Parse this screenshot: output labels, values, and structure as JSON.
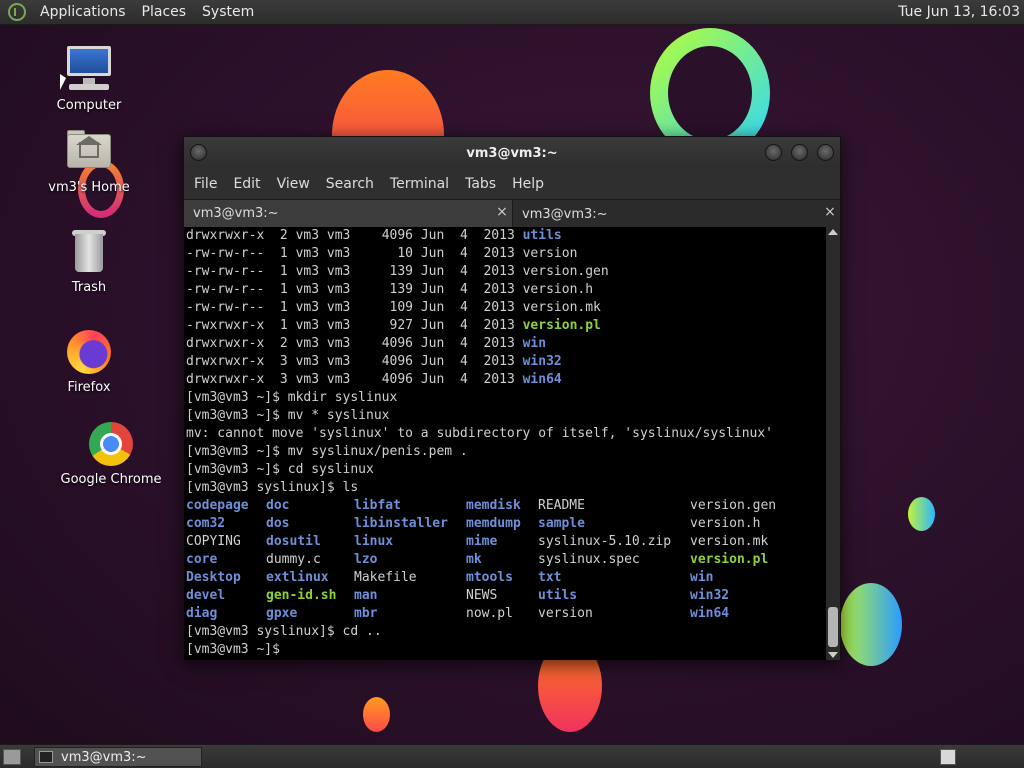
{
  "top_panel": {
    "menus": [
      "Applications",
      "Places",
      "System"
    ],
    "clock": "Tue Jun 13, 16:03"
  },
  "desktop_icons": [
    {
      "label": "Computer",
      "icon": "computer-icon"
    },
    {
      "label": "vm3's Home",
      "icon": "home-folder-icon"
    },
    {
      "label": "Trash",
      "icon": "trash-icon"
    },
    {
      "label": "Firefox",
      "icon": "firefox-icon"
    },
    {
      "label": "Google Chrome",
      "icon": "chrome-icon"
    }
  ],
  "terminal": {
    "title": "vm3@vm3:~",
    "menu": [
      "File",
      "Edit",
      "View",
      "Search",
      "Terminal",
      "Tabs",
      "Help"
    ],
    "tabs": [
      "vm3@vm3:~",
      "vm3@vm3:~"
    ],
    "listing": [
      {
        "perm": "drwxrwxr-x",
        "links": "2",
        "user": "vm3",
        "group": "vm3",
        "size": "4096",
        "month": "Jun",
        "day": "4",
        "year": "2013",
        "name": "utils",
        "kind": "dir"
      },
      {
        "perm": "-rw-rw-r--",
        "links": "1",
        "user": "vm3",
        "group": "vm3",
        "size": "10",
        "month": "Jun",
        "day": "4",
        "year": "2013",
        "name": "version",
        "kind": "file"
      },
      {
        "perm": "-rw-rw-r--",
        "links": "1",
        "user": "vm3",
        "group": "vm3",
        "size": "139",
        "month": "Jun",
        "day": "4",
        "year": "2013",
        "name": "version.gen",
        "kind": "file"
      },
      {
        "perm": "-rw-rw-r--",
        "links": "1",
        "user": "vm3",
        "group": "vm3",
        "size": "139",
        "month": "Jun",
        "day": "4",
        "year": "2013",
        "name": "version.h",
        "kind": "file"
      },
      {
        "perm": "-rw-rw-r--",
        "links": "1",
        "user": "vm3",
        "group": "vm3",
        "size": "109",
        "month": "Jun",
        "day": "4",
        "year": "2013",
        "name": "version.mk",
        "kind": "file"
      },
      {
        "perm": "-rwxrwxr-x",
        "links": "1",
        "user": "vm3",
        "group": "vm3",
        "size": "927",
        "month": "Jun",
        "day": "4",
        "year": "2013",
        "name": "version.pl",
        "kind": "exe"
      },
      {
        "perm": "drwxrwxr-x",
        "links": "2",
        "user": "vm3",
        "group": "vm3",
        "size": "4096",
        "month": "Jun",
        "day": "4",
        "year": "2013",
        "name": "win",
        "kind": "dir"
      },
      {
        "perm": "drwxrwxr-x",
        "links": "3",
        "user": "vm3",
        "group": "vm3",
        "size": "4096",
        "month": "Jun",
        "day": "4",
        "year": "2013",
        "name": "win32",
        "kind": "dir"
      },
      {
        "perm": "drwxrwxr-x",
        "links": "3",
        "user": "vm3",
        "group": "vm3",
        "size": "4096",
        "month": "Jun",
        "day": "4",
        "year": "2013",
        "name": "win64",
        "kind": "dir"
      }
    ],
    "commands": [
      "[vm3@vm3 ~]$ mkdir syslinux",
      "[vm3@vm3 ~]$ mv * syslinux",
      "mv: cannot move 'syslinux' to a subdirectory of itself, 'syslinux/syslinux'",
      "[vm3@vm3 ~]$ mv syslinux/penis.pem .",
      "[vm3@vm3 ~]$ cd syslinux",
      "[vm3@vm3 syslinux]$ ls"
    ],
    "ls_rows": [
      [
        {
          "t": "codepage",
          "k": "dir"
        },
        {
          "t": "doc",
          "k": "dir"
        },
        {
          "t": "libfat",
          "k": "dir"
        },
        {
          "t": "memdisk",
          "k": "dir"
        },
        {
          "t": "README",
          "k": "file"
        },
        {
          "t": "version.gen",
          "k": "file"
        }
      ],
      [
        {
          "t": "com32",
          "k": "dir"
        },
        {
          "t": "dos",
          "k": "dir"
        },
        {
          "t": "libinstaller",
          "k": "dir"
        },
        {
          "t": "memdump",
          "k": "dir"
        },
        {
          "t": "sample",
          "k": "dir"
        },
        {
          "t": "version.h",
          "k": "file"
        }
      ],
      [
        {
          "t": "COPYING",
          "k": "file"
        },
        {
          "t": "dosutil",
          "k": "dir"
        },
        {
          "t": "linux",
          "k": "dir"
        },
        {
          "t": "mime",
          "k": "dir"
        },
        {
          "t": "syslinux-5.10.zip",
          "k": "file"
        },
        {
          "t": "version.mk",
          "k": "file"
        }
      ],
      [
        {
          "t": "core",
          "k": "dir"
        },
        {
          "t": "dummy.c",
          "k": "file"
        },
        {
          "t": "lzo",
          "k": "dir"
        },
        {
          "t": "mk",
          "k": "dir"
        },
        {
          "t": "syslinux.spec",
          "k": "file"
        },
        {
          "t": "version.pl",
          "k": "exe"
        }
      ],
      [
        {
          "t": "Desktop",
          "k": "dir"
        },
        {
          "t": "extlinux",
          "k": "dir"
        },
        {
          "t": "Makefile",
          "k": "file"
        },
        {
          "t": "mtools",
          "k": "dir"
        },
        {
          "t": "txt",
          "k": "dir"
        },
        {
          "t": "win",
          "k": "dir"
        }
      ],
      [
        {
          "t": "devel",
          "k": "dir"
        },
        {
          "t": "gen-id.sh",
          "k": "exe"
        },
        {
          "t": "man",
          "k": "dir"
        },
        {
          "t": "NEWS",
          "k": "file"
        },
        {
          "t": "utils",
          "k": "dir"
        },
        {
          "t": "win32",
          "k": "dir"
        }
      ],
      [
        {
          "t": "diag",
          "k": "dir"
        },
        {
          "t": "gpxe",
          "k": "dir"
        },
        {
          "t": "mbr",
          "k": "dir"
        },
        {
          "t": "now.pl",
          "k": "file"
        },
        {
          "t": "version",
          "k": "file"
        },
        {
          "t": "win64",
          "k": "dir"
        }
      ]
    ],
    "after": [
      "[vm3@vm3 syslinux]$ cd ..",
      "[vm3@vm3 ~]$ "
    ]
  },
  "bottom_panel": {
    "task": "vm3@vm3:~"
  },
  "colors": {
    "dir": "#6f8fd8",
    "exe": "#8fd13a",
    "text": "#d0d0d0"
  }
}
